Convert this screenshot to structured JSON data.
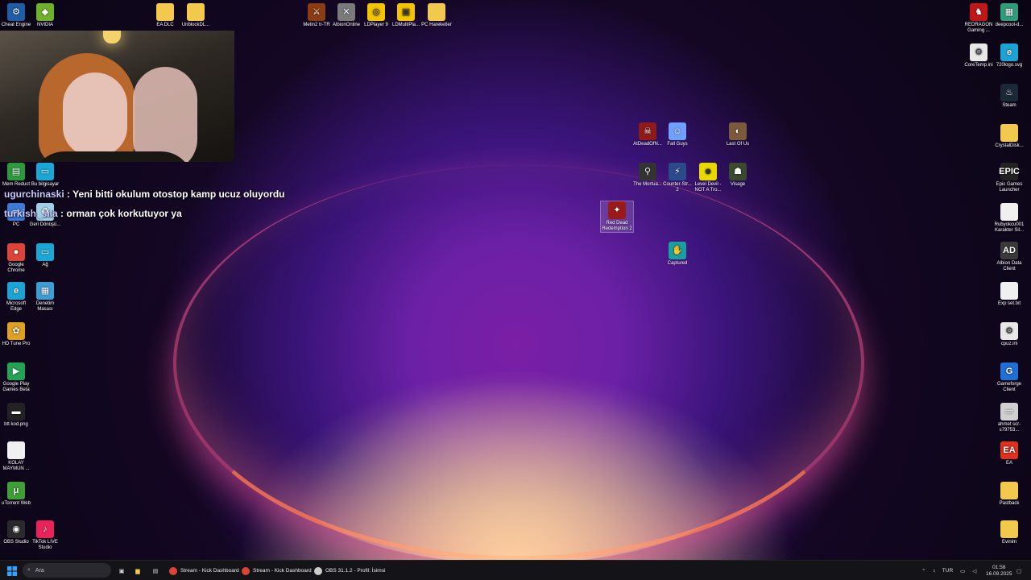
{
  "desktop": {
    "icons": [
      {
        "label": "Cheat Engine",
        "icon": "cheat-engine-icon",
        "color": "#1c5fa8",
        "glyph": "⚙"
      },
      {
        "label": "NVIDIA",
        "icon": "nvidia-icon",
        "color": "#6fb22a",
        "glyph": "◆"
      },
      {
        "label": "EA DLC",
        "icon": "folder-icon",
        "color": "#f2c94c",
        "glyph": ""
      },
      {
        "label": "UnblockDL...",
        "icon": "folder-icon",
        "color": "#f2c94c",
        "glyph": ""
      },
      {
        "label": "Metin2 tr-TR",
        "icon": "metin2-icon",
        "color": "#8a3d12",
        "glyph": "⚔"
      },
      {
        "label": "AlbionOnline",
        "icon": "albion-online-icon",
        "color": "#7a7a7a",
        "glyph": "✕"
      },
      {
        "label": "LDPlayer 9",
        "icon": "ldplayer-icon",
        "color": "#f4c400",
        "glyph": "◎"
      },
      {
        "label": "LDMultiPla...",
        "icon": "ldmultiplayer-icon",
        "color": "#f4c400",
        "glyph": "▣"
      },
      {
        "label": "PC Hareketler",
        "icon": "folder-icon",
        "color": "#f2c94c",
        "glyph": ""
      },
      {
        "label": "REDRAGON Gaming ...",
        "icon": "redragon-icon",
        "color": "#c01818",
        "glyph": "♞"
      },
      {
        "label": "deepcool-d...",
        "icon": "deepcool-icon",
        "color": "#2e9e7a",
        "glyph": "▦"
      },
      {
        "label": "CoreTemp.ini",
        "icon": "config-file-icon",
        "color": "#e8e8e8",
        "glyph": "⚙"
      },
      {
        "label": "720logo.svg",
        "icon": "edge-icon",
        "color": "#1ba3d6",
        "glyph": "e"
      },
      {
        "label": "Steam",
        "icon": "steam-icon",
        "color": "#1b2838",
        "glyph": "♨"
      },
      {
        "label": "CrystalDisk...",
        "icon": "folder-icon",
        "color": "#f2c94c",
        "glyph": ""
      },
      {
        "label": "Epic Games Launcher",
        "icon": "epic-games-icon",
        "color": "#222",
        "glyph": "EPIC"
      },
      {
        "label": "Rubyokcu001 Karakter Sil...",
        "icon": "text-file-icon",
        "color": "#f0f0f0",
        "glyph": ""
      },
      {
        "label": "Albion Data Client",
        "icon": "albion-data-icon",
        "color": "#3a3a3a",
        "glyph": "AD"
      },
      {
        "label": "Exp set.txt",
        "icon": "text-file-icon",
        "color": "#f0f0f0",
        "glyph": ""
      },
      {
        "label": "cpuz.ini",
        "icon": "config-file-icon",
        "color": "#e8e8e8",
        "glyph": "⚙"
      },
      {
        "label": "Gameforge Client",
        "icon": "gameforge-icon",
        "color": "#1f6fd6",
        "glyph": "G"
      },
      {
        "label": "ahmet scr-s79753...",
        "icon": "image-file-icon",
        "color": "#d0d0d0",
        "glyph": "▭"
      },
      {
        "label": "EA",
        "icon": "ea-icon",
        "color": "#e0301e",
        "glyph": "EA"
      },
      {
        "label": "Pastback",
        "icon": "folder-icon",
        "color": "#f2c94c",
        "glyph": ""
      },
      {
        "label": "Evinim",
        "icon": "folder-icon",
        "color": "#f2c94c",
        "glyph": ""
      },
      {
        "label": "Mem Reduct",
        "icon": "mem-reduct-icon",
        "color": "#2a9b3a",
        "glyph": "▤"
      },
      {
        "label": "Bu bilgisayar",
        "icon": "this-pc-icon",
        "color": "#1aa7d6",
        "glyph": "▭"
      },
      {
        "label": "PC",
        "icon": "pc-folder-icon",
        "color": "#3b7ad6",
        "glyph": "▭"
      },
      {
        "label": "Geri Dönüşü...",
        "icon": "recycle-bin-icon",
        "color": "#9fd0e8",
        "glyph": "♻"
      },
      {
        "label": "Google Chrome",
        "icon": "chrome-icon",
        "color": "#db4437",
        "glyph": "●"
      },
      {
        "label": "Ağ",
        "icon": "network-icon",
        "color": "#1aa7d6",
        "glyph": "▭"
      },
      {
        "label": "Microsoft Edge",
        "icon": "edge-icon",
        "color": "#1ba3d6",
        "glyph": "e"
      },
      {
        "label": "Denetim Masası",
        "icon": "control-panel-icon",
        "color": "#3b9fd6",
        "glyph": "▦"
      },
      {
        "label": "HD Tune Pro",
        "icon": "hd-tune-icon",
        "color": "#e0a020",
        "glyph": "✿"
      },
      {
        "label": "Google Play Games Beta",
        "icon": "play-games-icon",
        "color": "#23a455",
        "glyph": "▶"
      },
      {
        "label": "btt kod.png",
        "icon": "image-file-icon",
        "color": "#222",
        "glyph": "▬"
      },
      {
        "label": "KOLAY MAYMUN ...",
        "icon": "text-file-icon",
        "color": "#f0f0f0",
        "glyph": ""
      },
      {
        "label": "uTorrent Web",
        "icon": "utorrent-icon",
        "color": "#3da034",
        "glyph": "μ"
      },
      {
        "label": "OBS Studio",
        "icon": "obs-icon",
        "color": "#2a2a2a",
        "glyph": "◉"
      },
      {
        "label": "TikTok LIVE Studio",
        "icon": "tiktok-icon",
        "color": "#e8235a",
        "glyph": "♪"
      },
      {
        "label": "AtDeadOfN...",
        "icon": "at-dead-of-night-icon",
        "color": "#8e1a1a",
        "glyph": "☠"
      },
      {
        "label": "Fall Guys",
        "icon": "fall-guys-icon",
        "color": "#6fa0ff",
        "glyph": "☺"
      },
      {
        "label": "Last Of Us",
        "icon": "last-of-us-icon",
        "color": "#7a5a3a",
        "glyph": "◐"
      },
      {
        "label": "The Mortua...",
        "icon": "mortuary-icon",
        "color": "#333",
        "glyph": "⚲"
      },
      {
        "label": "Counter-Str... 2",
        "icon": "counter-strike-icon",
        "color": "#2a4a8a",
        "glyph": "⚡"
      },
      {
        "label": "Level Devil - NOT A Tro...",
        "icon": "level-devil-icon",
        "color": "#e8d800",
        "glyph": "☻"
      },
      {
        "label": "Visage",
        "icon": "visage-icon",
        "color": "#3a4a2a",
        "glyph": "☗"
      },
      {
        "label": "Red Dead Redemption 2",
        "icon": "rdr2-icon",
        "color": "#9a1a1a",
        "glyph": "✦"
      },
      {
        "label": "Captured",
        "icon": "captured-icon",
        "color": "#1aa0a0",
        "glyph": "✋"
      }
    ]
  },
  "chat": [
    {
      "user": "ugurchinaski",
      "message": " : Yeni bitti okulum otostop kamp ucuz oluyordu"
    },
    {
      "user": "turkish_sila",
      "message": " : orman çok korkutuyor ya"
    }
  ],
  "taskbar": {
    "search_placeholder": "Ara",
    "tasks": [
      {
        "label": "Stream - Kick Dashboard",
        "icon": "chrome-icon",
        "color": "#db4437"
      },
      {
        "label": "Stream - Kick Dashboard",
        "icon": "chrome-icon",
        "color": "#db4437"
      },
      {
        "label": "OBS 31.1.2 - Profil: İsimsi",
        "icon": "obs-icon",
        "color": "#cccccc"
      }
    ],
    "language": "TUR",
    "time": "01:58",
    "date": "16.09.2025"
  }
}
